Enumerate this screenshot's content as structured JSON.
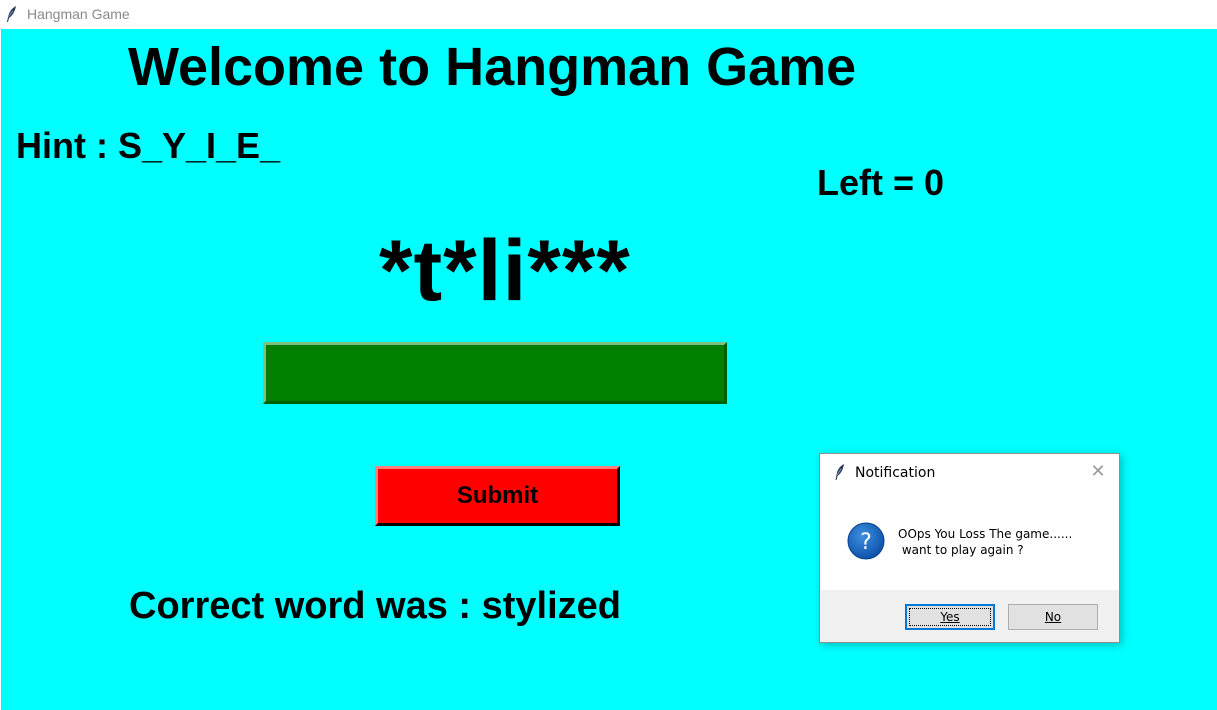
{
  "window": {
    "title": "Hangman Game"
  },
  "game": {
    "heading": "Welcome to Hangman Game",
    "hint": "Hint : S_Y_I_E_",
    "left": "Left = 0",
    "masked_word": "*t*li***",
    "guess_value": "",
    "submit_label": "Submit",
    "correct_word": "Correct word was : stylized"
  },
  "dialog": {
    "title": "Notification",
    "close_icon": "✕",
    "message": "OOps You Loss The game......\n want to play again ?",
    "yes_label": "Yes",
    "no_label": "No"
  },
  "colors": {
    "background": "#00ffff",
    "input_bg": "#007f00",
    "submit_bg": "#ff0000",
    "dialog_accent": "#0078d7"
  }
}
